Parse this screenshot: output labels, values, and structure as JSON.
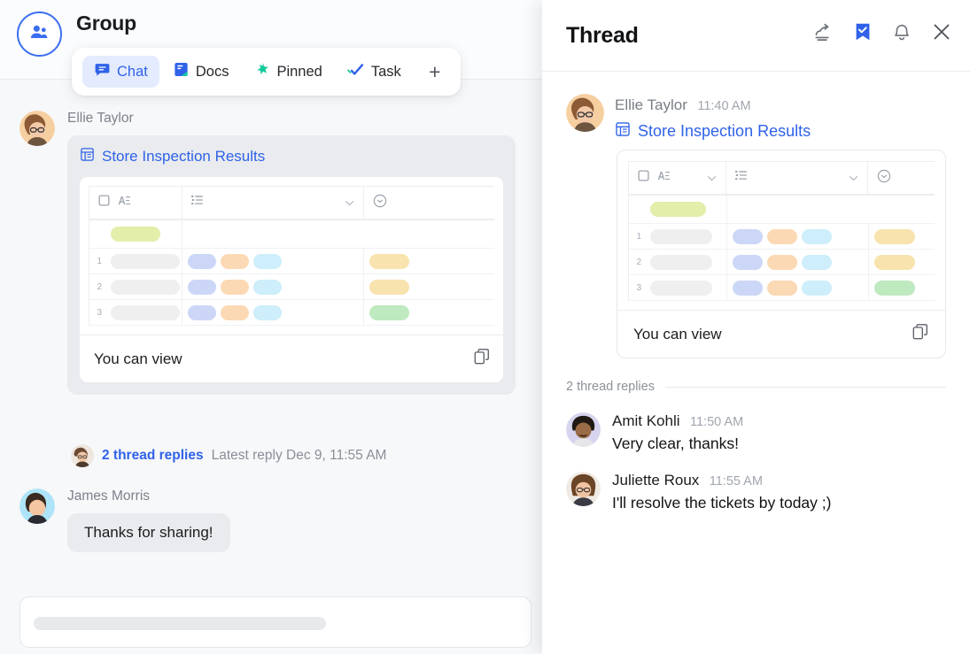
{
  "group": {
    "title": "Group",
    "avatar_icon": "people-icon",
    "tabs": [
      {
        "label": "Chat",
        "icon": "chat-bubble-icon",
        "active": true
      },
      {
        "label": "Docs",
        "icon": "docs-icon",
        "active": false
      },
      {
        "label": "Pinned",
        "icon": "pin-star-icon",
        "active": false
      },
      {
        "label": "Task",
        "icon": "double-check-icon",
        "active": false
      }
    ],
    "add_tab_label": "+"
  },
  "left_messages": {
    "doc_message": {
      "sender": "Ellie Taylor",
      "doc_icon": "spreadsheet-icon",
      "doc_title": "Store Inspection Results",
      "permission_text": "You can view",
      "copy_icon": "copy-icon"
    },
    "thread_summary": {
      "replies_link": "2 thread replies",
      "latest_reply": "Latest reply Dec 9, 11:55 AM"
    },
    "text_message": {
      "sender": "James Morris",
      "text": "Thanks for sharing!"
    }
  },
  "composer": {
    "placeholder": ""
  },
  "thread": {
    "title": "Thread",
    "actions": [
      {
        "name": "forward-icon",
        "label": "Forward"
      },
      {
        "name": "bookmark-check-icon",
        "label": "Saved"
      },
      {
        "name": "bell-icon",
        "label": "Notifications"
      },
      {
        "name": "close-icon",
        "label": "Close"
      }
    ],
    "root_message": {
      "sender": "Ellie Taylor",
      "time": "11:40 AM",
      "doc_icon": "spreadsheet-icon",
      "doc_title": "Store Inspection Results",
      "permission_text": "You can view",
      "copy_icon": "copy-icon"
    },
    "replies_label": "2 thread replies",
    "replies": [
      {
        "sender": "Amit Kohli",
        "time": "11:50 AM",
        "text": "Very clear, thanks!"
      },
      {
        "sender": "Juliette Roux",
        "time": "11:55 AM",
        "text": "I'll resolve the tickets by today ;)"
      }
    ]
  },
  "sheet": {
    "toolbar": {
      "checkbox_icon": "checkbox-icon",
      "text_format_icon": "text-format-icon",
      "list_icon": "list-icon",
      "status_icon": "status-circle-icon",
      "caret_icon": "chevron-down-icon"
    },
    "header_row": {
      "pill_color": "#e3eeaa"
    },
    "rows": [
      {
        "num": "1",
        "name_pill": "#efefef",
        "tag_pills": [
          "#ccd7f7",
          "#fbd9b4",
          "#cdeefa"
        ],
        "status_pill": "#f8e3ae"
      },
      {
        "num": "2",
        "name_pill": "#efefef",
        "tag_pills": [
          "#ccd7f7",
          "#fbd9b4",
          "#cdeefa"
        ],
        "status_pill": "#f8e3ae"
      },
      {
        "num": "3",
        "name_pill": "#efefef",
        "tag_pills": [
          "#ccd7f7",
          "#fbd9b4",
          "#cdeefa"
        ],
        "status_pill": "#bfe9bf"
      }
    ]
  },
  "colors": {
    "accent_blue": "#2f62e8",
    "tab_active_bg": "#e4ebfe",
    "docs_green": "#12c99b",
    "page_bg": "#f7f8fa",
    "card_bg": "#e9ebee"
  }
}
